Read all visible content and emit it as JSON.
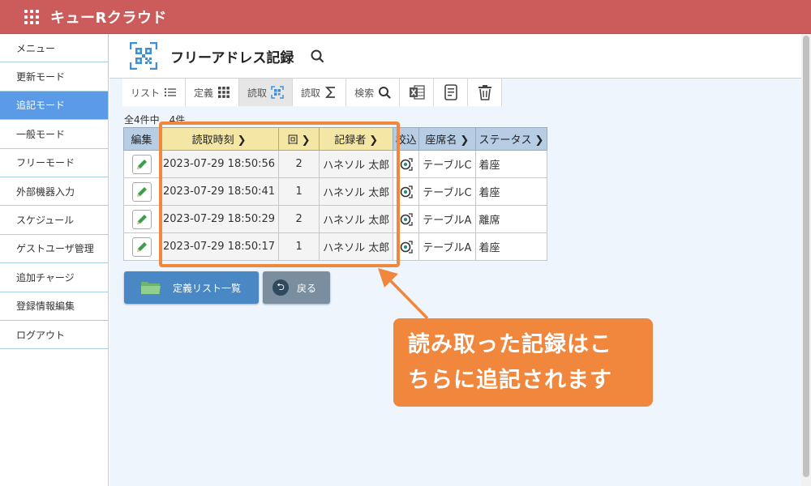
{
  "header": {
    "app_title": "キューRクラウド"
  },
  "sidebar": {
    "items": [
      {
        "label": "メニュー"
      },
      {
        "label": "更新モード"
      },
      {
        "label": "追記モード",
        "active": true
      },
      {
        "label": "一般モード"
      },
      {
        "label": "フリーモード"
      },
      {
        "label": "外部機器入力"
      },
      {
        "label": "スケジュール"
      },
      {
        "label": "ゲストユーザ管理"
      },
      {
        "label": "追加チャージ"
      },
      {
        "label": "登録情報編集"
      },
      {
        "label": "ログアウト"
      }
    ]
  },
  "page": {
    "title": "フリーアドレス記録",
    "icon": "qr-code-icon"
  },
  "tabs": [
    {
      "label": "リスト",
      "icon": "list-icon"
    },
    {
      "label": "定義",
      "icon": "grid-dots-icon"
    },
    {
      "label": "読取",
      "icon": "qr-scan-icon",
      "active": true
    },
    {
      "label": "読取",
      "icon": "sigma-icon"
    },
    {
      "label": "検索",
      "icon": "search-icon"
    },
    {
      "label": "",
      "icon": "excel-icon"
    },
    {
      "label": "",
      "icon": "document-icon"
    },
    {
      "label": "",
      "icon": "trash-icon"
    }
  ],
  "count_text": "全4件中　4件",
  "table": {
    "headers": [
      "編集",
      "読取時刻",
      "回",
      "記録者",
      "校込",
      "座席名",
      "ステータス"
    ],
    "rows": [
      {
        "time": "2023-07-29 18:50:56",
        "count": "2",
        "recorder": "ハネソル 太郎",
        "seat": "テーブルC",
        "status": "着座"
      },
      {
        "time": "2023-07-29 18:50:41",
        "count": "1",
        "recorder": "ハネソル 太郎",
        "seat": "テーブルC",
        "status": "着座"
      },
      {
        "time": "2023-07-29 18:50:29",
        "count": "2",
        "recorder": "ハネソル 太郎",
        "seat": "テーブルA",
        "status": "離席"
      },
      {
        "time": "2023-07-29 18:50:17",
        "count": "1",
        "recorder": "ハネソル 太郎",
        "seat": "テーブルA",
        "status": "着座"
      }
    ]
  },
  "buttons": {
    "list_label": "定義リスト一覧",
    "back_label": "戻る"
  },
  "callout": {
    "line1": "読み取った記録はこ",
    "line2": "ちらに追記されます"
  },
  "colors": {
    "header": "#cc5b5b",
    "accent_blue": "#5a9ae6",
    "highlight": "#f0873d"
  }
}
